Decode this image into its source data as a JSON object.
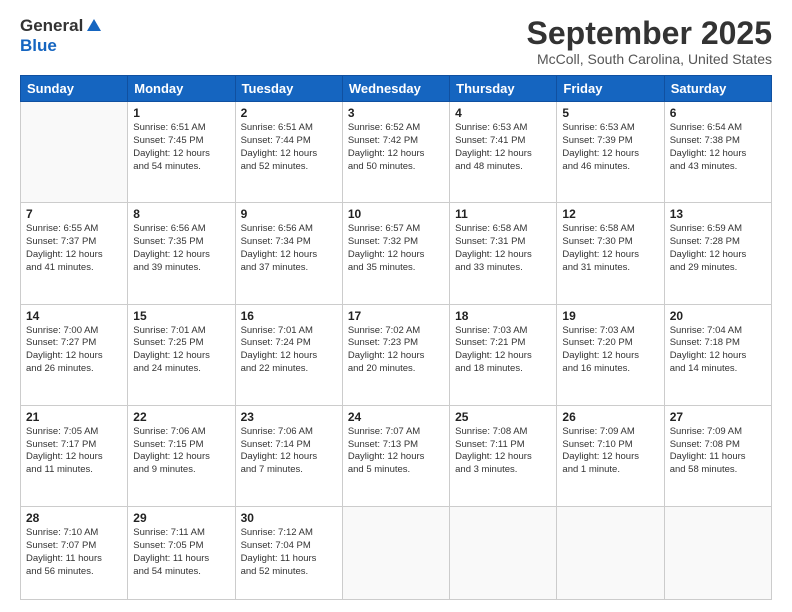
{
  "logo": {
    "general": "General",
    "blue": "Blue"
  },
  "title": "September 2025",
  "location": "McColl, South Carolina, United States",
  "weekdays": [
    "Sunday",
    "Monday",
    "Tuesday",
    "Wednesday",
    "Thursday",
    "Friday",
    "Saturday"
  ],
  "weeks": [
    [
      {
        "day": "",
        "info": ""
      },
      {
        "day": "1",
        "info": "Sunrise: 6:51 AM\nSunset: 7:45 PM\nDaylight: 12 hours\nand 54 minutes."
      },
      {
        "day": "2",
        "info": "Sunrise: 6:51 AM\nSunset: 7:44 PM\nDaylight: 12 hours\nand 52 minutes."
      },
      {
        "day": "3",
        "info": "Sunrise: 6:52 AM\nSunset: 7:42 PM\nDaylight: 12 hours\nand 50 minutes."
      },
      {
        "day": "4",
        "info": "Sunrise: 6:53 AM\nSunset: 7:41 PM\nDaylight: 12 hours\nand 48 minutes."
      },
      {
        "day": "5",
        "info": "Sunrise: 6:53 AM\nSunset: 7:39 PM\nDaylight: 12 hours\nand 46 minutes."
      },
      {
        "day": "6",
        "info": "Sunrise: 6:54 AM\nSunset: 7:38 PM\nDaylight: 12 hours\nand 43 minutes."
      }
    ],
    [
      {
        "day": "7",
        "info": "Sunrise: 6:55 AM\nSunset: 7:37 PM\nDaylight: 12 hours\nand 41 minutes."
      },
      {
        "day": "8",
        "info": "Sunrise: 6:56 AM\nSunset: 7:35 PM\nDaylight: 12 hours\nand 39 minutes."
      },
      {
        "day": "9",
        "info": "Sunrise: 6:56 AM\nSunset: 7:34 PM\nDaylight: 12 hours\nand 37 minutes."
      },
      {
        "day": "10",
        "info": "Sunrise: 6:57 AM\nSunset: 7:32 PM\nDaylight: 12 hours\nand 35 minutes."
      },
      {
        "day": "11",
        "info": "Sunrise: 6:58 AM\nSunset: 7:31 PM\nDaylight: 12 hours\nand 33 minutes."
      },
      {
        "day": "12",
        "info": "Sunrise: 6:58 AM\nSunset: 7:30 PM\nDaylight: 12 hours\nand 31 minutes."
      },
      {
        "day": "13",
        "info": "Sunrise: 6:59 AM\nSunset: 7:28 PM\nDaylight: 12 hours\nand 29 minutes."
      }
    ],
    [
      {
        "day": "14",
        "info": "Sunrise: 7:00 AM\nSunset: 7:27 PM\nDaylight: 12 hours\nand 26 minutes."
      },
      {
        "day": "15",
        "info": "Sunrise: 7:01 AM\nSunset: 7:25 PM\nDaylight: 12 hours\nand 24 minutes."
      },
      {
        "day": "16",
        "info": "Sunrise: 7:01 AM\nSunset: 7:24 PM\nDaylight: 12 hours\nand 22 minutes."
      },
      {
        "day": "17",
        "info": "Sunrise: 7:02 AM\nSunset: 7:23 PM\nDaylight: 12 hours\nand 20 minutes."
      },
      {
        "day": "18",
        "info": "Sunrise: 7:03 AM\nSunset: 7:21 PM\nDaylight: 12 hours\nand 18 minutes."
      },
      {
        "day": "19",
        "info": "Sunrise: 7:03 AM\nSunset: 7:20 PM\nDaylight: 12 hours\nand 16 minutes."
      },
      {
        "day": "20",
        "info": "Sunrise: 7:04 AM\nSunset: 7:18 PM\nDaylight: 12 hours\nand 14 minutes."
      }
    ],
    [
      {
        "day": "21",
        "info": "Sunrise: 7:05 AM\nSunset: 7:17 PM\nDaylight: 12 hours\nand 11 minutes."
      },
      {
        "day": "22",
        "info": "Sunrise: 7:06 AM\nSunset: 7:15 PM\nDaylight: 12 hours\nand 9 minutes."
      },
      {
        "day": "23",
        "info": "Sunrise: 7:06 AM\nSunset: 7:14 PM\nDaylight: 12 hours\nand 7 minutes."
      },
      {
        "day": "24",
        "info": "Sunrise: 7:07 AM\nSunset: 7:13 PM\nDaylight: 12 hours\nand 5 minutes."
      },
      {
        "day": "25",
        "info": "Sunrise: 7:08 AM\nSunset: 7:11 PM\nDaylight: 12 hours\nand 3 minutes."
      },
      {
        "day": "26",
        "info": "Sunrise: 7:09 AM\nSunset: 7:10 PM\nDaylight: 12 hours\nand 1 minute."
      },
      {
        "day": "27",
        "info": "Sunrise: 7:09 AM\nSunset: 7:08 PM\nDaylight: 11 hours\nand 58 minutes."
      }
    ],
    [
      {
        "day": "28",
        "info": "Sunrise: 7:10 AM\nSunset: 7:07 PM\nDaylight: 11 hours\nand 56 minutes."
      },
      {
        "day": "29",
        "info": "Sunrise: 7:11 AM\nSunset: 7:05 PM\nDaylight: 11 hours\nand 54 minutes."
      },
      {
        "day": "30",
        "info": "Sunrise: 7:12 AM\nSunset: 7:04 PM\nDaylight: 11 hours\nand 52 minutes."
      },
      {
        "day": "",
        "info": ""
      },
      {
        "day": "",
        "info": ""
      },
      {
        "day": "",
        "info": ""
      },
      {
        "day": "",
        "info": ""
      }
    ]
  ]
}
